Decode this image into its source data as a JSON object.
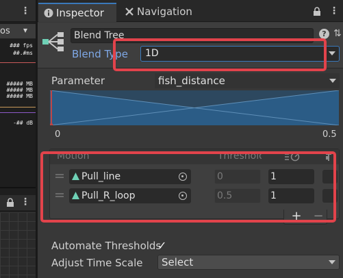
{
  "left_panel": {
    "os_label": "os",
    "stats": [
      "### fps",
      "##.#ms",
      "##### MB",
      "##### MB",
      "##### MB",
      "-## dB"
    ]
  },
  "tabs": [
    {
      "label": "Inspector",
      "icon": "info-icon",
      "active": true
    },
    {
      "label": "Navigation",
      "icon": "navigation-icon",
      "active": false
    }
  ],
  "header": {
    "name": "Blend Tree",
    "blend_type_label": "Blend Type",
    "blend_type_value": "1D"
  },
  "parameter": {
    "label": "Parameter",
    "value": "fish_distance",
    "range_min": "0",
    "range_max": "0.5"
  },
  "motion_list": {
    "col_motion": "Motion",
    "col_threshold": "Threshold",
    "rows": [
      {
        "clip": "Pull_line",
        "threshold": "0",
        "speed": "1"
      },
      {
        "clip": "Pull_R_loop",
        "threshold": "0.5",
        "speed": "1"
      }
    ],
    "add_label": "+",
    "remove_label": "−"
  },
  "bottom": {
    "automate_label": "Automate Thresholds",
    "automate_checked": true,
    "adjust_label": "Adjust Time Scale",
    "adjust_value": "Select"
  },
  "colors": {
    "accent_blue": "#3a79bb",
    "label_blue": "#7fa8e6",
    "annotation_red": "#e2434b",
    "graph_fill": "#2b5c86"
  }
}
